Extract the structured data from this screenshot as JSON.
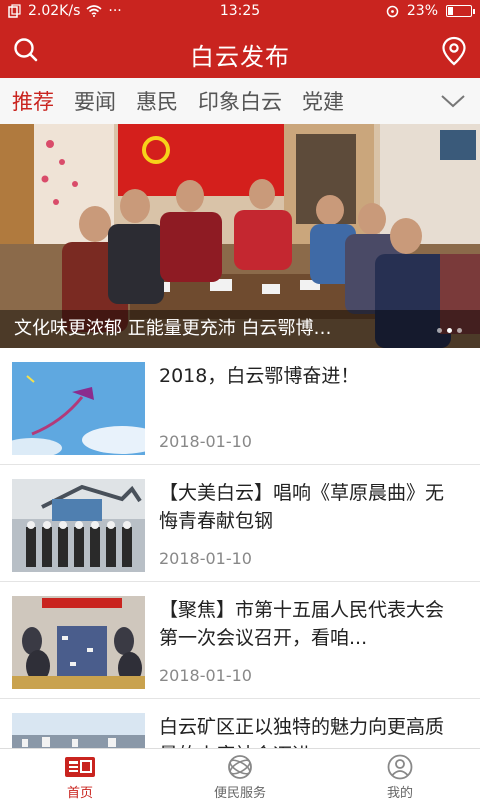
{
  "status_bar": {
    "speed": "2.02K/s",
    "dots": "···",
    "time": "13:25",
    "battery": "23%",
    "battery_level": 0.23
  },
  "header": {
    "title": "白云发布",
    "search_icon": "search-icon",
    "location_icon": "location-pin-icon"
  },
  "tabs": [
    {
      "label": "推荐",
      "active": true
    },
    {
      "label": "要闻",
      "active": false
    },
    {
      "label": "惠民",
      "active": false
    },
    {
      "label": "印象白云",
      "active": false
    },
    {
      "label": "党建",
      "active": false
    }
  ],
  "banner": {
    "caption": "文化味更浓郁 正能量更充沛 白云鄂博…",
    "slides": 3,
    "active_slide": 1
  },
  "news": [
    {
      "title": "2018，白云鄂博奋进！",
      "date": "2018-01-10"
    },
    {
      "title": "【大美白云】唱响《草原晨曲》无悔青春献包钢",
      "date": "2018-01-10"
    },
    {
      "title": "【聚焦】市第十五届人民代表大会第一次会议召开，看咱...",
      "date": "2018-01-10"
    },
    {
      "title": "白云矿区正以独特的魅力向更高质量的小康社会迈进",
      "date": ""
    }
  ],
  "bottom_nav": [
    {
      "label": "首页",
      "icon": "home-newspaper-icon",
      "active": true
    },
    {
      "label": "便民服务",
      "icon": "service-globe-icon",
      "active": false
    },
    {
      "label": "我的",
      "icon": "user-profile-icon",
      "active": false
    }
  ],
  "colors": {
    "brand_red": "#c9241f",
    "tab_bg": "#f7f7f7",
    "date_gray": "#888888"
  }
}
